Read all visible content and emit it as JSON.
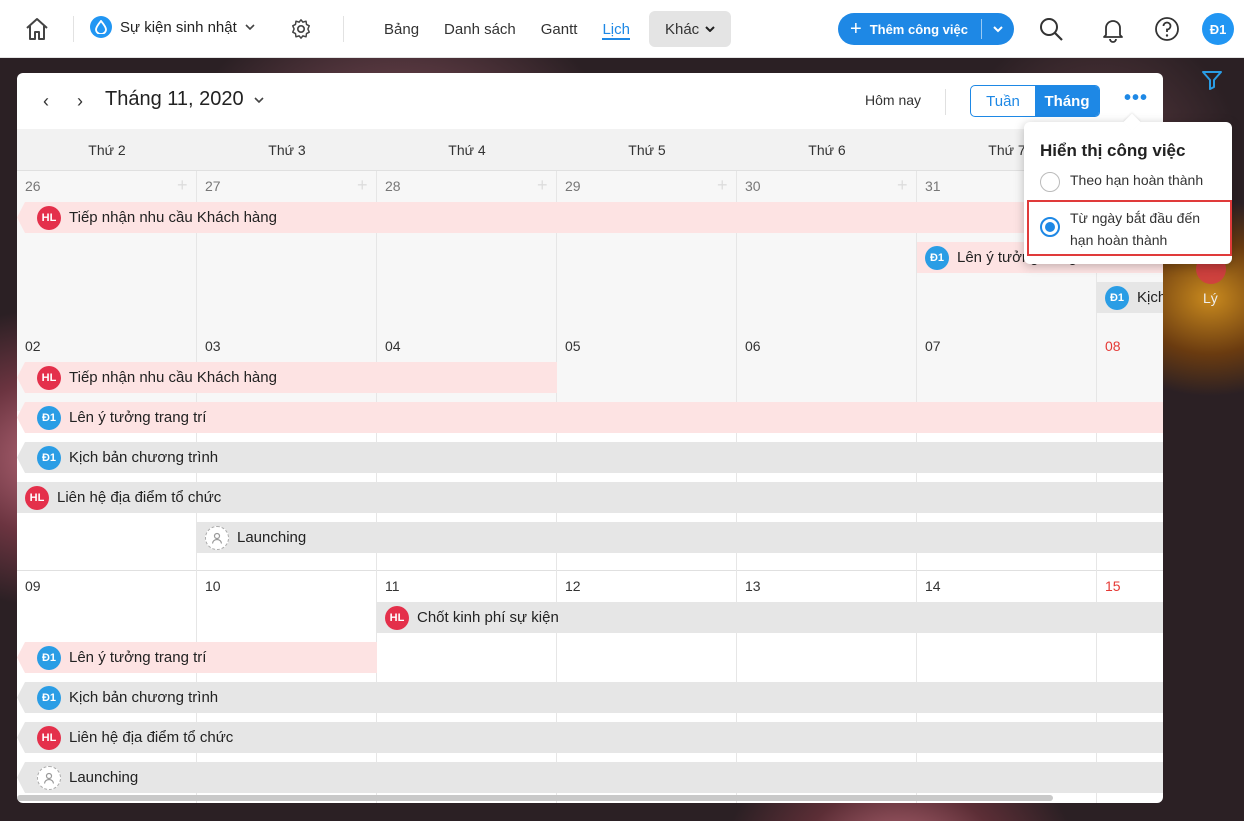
{
  "header": {
    "project_name": "Sự kiện sinh nhật",
    "tabs": [
      "Bảng",
      "Danh sách",
      "Gantt",
      "Lịch"
    ],
    "more_tab": "Khác",
    "add_button": "Thêm công việc",
    "user_initials": "Đ1",
    "accent_color": "#1e88e5"
  },
  "calendar": {
    "month_label": "Tháng 11, 2020",
    "today_label": "Hôm nay",
    "view_week": "Tuần",
    "view_month": "Tháng",
    "weekdays": [
      "Thứ 2",
      "Thứ 3",
      "Thứ 4",
      "Thứ 5",
      "Thứ 6",
      "Thứ 7"
    ],
    "weeks": [
      {
        "days": [
          "26",
          "27",
          "28",
          "29",
          "30",
          "31"
        ]
      },
      {
        "days": [
          "02",
          "03",
          "04",
          "05",
          "06",
          "07",
          "08"
        ]
      },
      {
        "days": [
          "09",
          "10",
          "11",
          "12",
          "13",
          "14",
          "15"
        ]
      }
    ],
    "events": {
      "w1": [
        "Tiếp nhận nhu cầu Khách hàng",
        "Lên ý tưởng trang trí",
        "Kịch bản chương trình"
      ],
      "w2": [
        "Tiếp nhận nhu cầu Khách hàng",
        "Lên ý tưởng trang trí",
        "Kịch bản chương trình",
        "Liên hệ địa điểm tổ chức",
        "Launching"
      ],
      "w3": [
        "Chốt kinh phí sự kiện",
        "Lên ý tưởng trang trí",
        "Kịch bản chương trình",
        "Liên hệ địa điểm tổ chức",
        "Launching"
      ]
    },
    "avatars": {
      "hl": "HL",
      "d1": "Đ1"
    }
  },
  "popup": {
    "title": "Hiển thị công việc",
    "option1": "Theo hạn hoàn thành",
    "option2": "Từ ngày bắt đầu đến hạn hoàn thành",
    "selected": 2
  },
  "rail": {
    "label": "Lý"
  }
}
